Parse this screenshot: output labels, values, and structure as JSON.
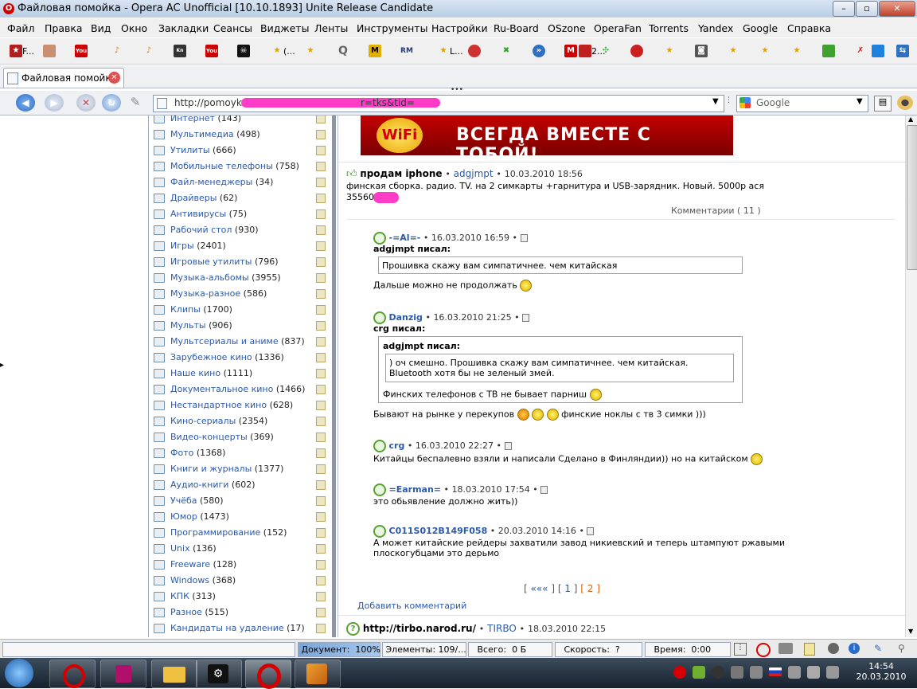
{
  "window": {
    "title": "Файловая помойка - Opera AC Unofficial [10.10.1893] Unite Release Candidate"
  },
  "menu": [
    "Файл",
    "Правка",
    "Вид",
    "Окно",
    "Закладки",
    "Сеансы",
    "Виджеты",
    "Ленты",
    "Инструменты",
    "Настройки",
    "Ru-Board",
    "OSzone",
    "OperaFan",
    "Torrents",
    "Yandex",
    "Google",
    "Справка"
  ],
  "bookmarks": [
    "F...",
    "",
    "",
    "",
    "",
    "",
    "",
    "",
    "(...",
    "",
    "",
    "",
    "",
    "",
    "",
    "L...",
    "",
    "",
    "",
    "",
    "2...",
    "",
    "",
    "",
    "",
    "",
    "",
    "",
    "",
    "",
    "",
    ""
  ],
  "tab": {
    "label": "Файловая помойка"
  },
  "address": {
    "url": "http://pomoyka",
    "url_tail": "r=tks&tid="
  },
  "search": {
    "engine": "Google"
  },
  "categories": [
    {
      "name": "Интернет",
      "count": "(143)"
    },
    {
      "name": "Мультимедиа",
      "count": "(498)"
    },
    {
      "name": "Утилиты",
      "count": "(666)"
    },
    {
      "name": "Мобильные телефоны",
      "count": "(758)"
    },
    {
      "name": "Файл-менеджеры",
      "count": "(34)"
    },
    {
      "name": "Драйверы",
      "count": "(62)"
    },
    {
      "name": "Антивирусы",
      "count": "(75)"
    },
    {
      "name": "Рабочий стол",
      "count": "(930)"
    },
    {
      "name": "Игры",
      "count": "(2401)"
    },
    {
      "name": "Игровые утилиты",
      "count": "(796)"
    },
    {
      "name": "Музыка-альбомы",
      "count": "(3955)"
    },
    {
      "name": "Музыка-разное",
      "count": "(586)"
    },
    {
      "name": "Клипы",
      "count": "(1700)"
    },
    {
      "name": "Мульты",
      "count": "(906)"
    },
    {
      "name": "Мультсериалы и аниме",
      "count": "(837)"
    },
    {
      "name": "Зарубежное кино",
      "count": "(1336)"
    },
    {
      "name": "Наше кино",
      "count": "(1111)"
    },
    {
      "name": "Документальное кино",
      "count": "(1466)"
    },
    {
      "name": "Нестандартное кино",
      "count": "(628)"
    },
    {
      "name": "Кино-сериалы",
      "count": "(2354)"
    },
    {
      "name": "Видео-концерты",
      "count": "(369)"
    },
    {
      "name": "Фото",
      "count": "(1368)"
    },
    {
      "name": "Книги и журналы",
      "count": "(1377)"
    },
    {
      "name": "Аудио-книги",
      "count": "(602)"
    },
    {
      "name": "Учёба",
      "count": "(580)"
    },
    {
      "name": "Юмор",
      "count": "(1473)"
    },
    {
      "name": "Программирование",
      "count": "(152)"
    },
    {
      "name": "Unix",
      "count": "(136)"
    },
    {
      "name": "Freeware",
      "count": "(128)"
    },
    {
      "name": "Windows",
      "count": "(368)"
    },
    {
      "name": "КПК",
      "count": "(313)"
    },
    {
      "name": "Разное",
      "count": "(515)"
    },
    {
      "name": "Кандидаты на удаление",
      "count": "(17)"
    }
  ],
  "banner": {
    "logo": "WiFi",
    "slogan": "ВСЕГДА ВМЕСТЕ С ТОБОЙ!"
  },
  "post": {
    "title": "продам iphone",
    "author": "adgjmpt",
    "date": "10.03.2010 18:56",
    "body": "финская сборка. радио. TV. на 2 симкарты +гарнитура и USB-зарядник. Новый. 5000р ася",
    "body2": "35560",
    "comments_label": "Комментарии",
    "comments_count": "11"
  },
  "comments": [
    {
      "author": "-=Al=-",
      "date": "16.03.2010 16:59",
      "quote_author": "adgjmpt писал:",
      "quote": "Прошивка скажу вам симпатичнее. чем китайская",
      "text": "Дальше можно не продолжать"
    },
    {
      "author": "Danzig",
      "date": "16.03.2010 21:25",
      "quote_author": "crg писал:",
      "inner_quote_author": "adgjmpt писал:",
      "inner_quote": ") оч смешно. Прошивка скажу вам симпатичнее. чем китайская. Bluetooth хотя бы не зеленый змей.",
      "quote_text": "Финских телефонов с ТВ не бывает парниш",
      "text": "Бывают на рынке у перекупов",
      "text2": "финские ноклы с тв 3 симки )))"
    },
    {
      "author": "crg",
      "date": "16.03.2010 22:27",
      "text": "Китайцы беспалевно взяли и написали Сделано в Финляндии)) но на китайском"
    },
    {
      "author": "=Earman=",
      "date": "18.03.2010 17:54",
      "text": "это обьявление должно жить))"
    },
    {
      "author": "C011S012B149F058",
      "date": "20.03.2010 14:16",
      "text": "А может китайские рейдеры захватили завод никиевский и теперь штампуют ржавыми",
      "text2": "плоскогубцами это дерьмо"
    }
  ],
  "pagination": {
    "prev": "«««",
    "p1": "1",
    "p2": "2"
  },
  "add_comment": "Добавить комментарий",
  "next_post": {
    "title": "http://tirbo.narod.ru/",
    "author": "TIRBO",
    "date": "18.03.2010 22:15"
  },
  "status": {
    "document_label": "Документ:",
    "document_value": "100%",
    "elements_label": "Элементы:",
    "elements_value": "109/...",
    "total_label": "Всего:",
    "total_value": "0 Б",
    "speed_label": "Скорость:",
    "speed_value": "?",
    "time_label": "Время:",
    "time_value": "0:00"
  },
  "clock": {
    "time": "14:54",
    "date": "20.03.2010"
  },
  "colors": {
    "link": "#2a5aa8",
    "banner": "#c40000",
    "pager": "#e06010"
  }
}
